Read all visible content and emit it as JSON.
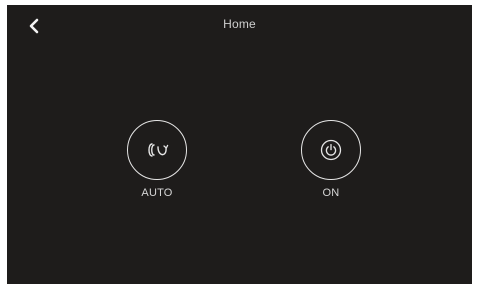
{
  "header": {
    "title": "Home",
    "back_icon": "chevron-left-icon"
  },
  "controls": [
    {
      "label": "AUTO",
      "icon": "auto-mode-icon"
    },
    {
      "label": "ON",
      "icon": "power-icon"
    }
  ],
  "colors": {
    "background": "#1e1c1b",
    "foreground": "#e6e6e6"
  }
}
